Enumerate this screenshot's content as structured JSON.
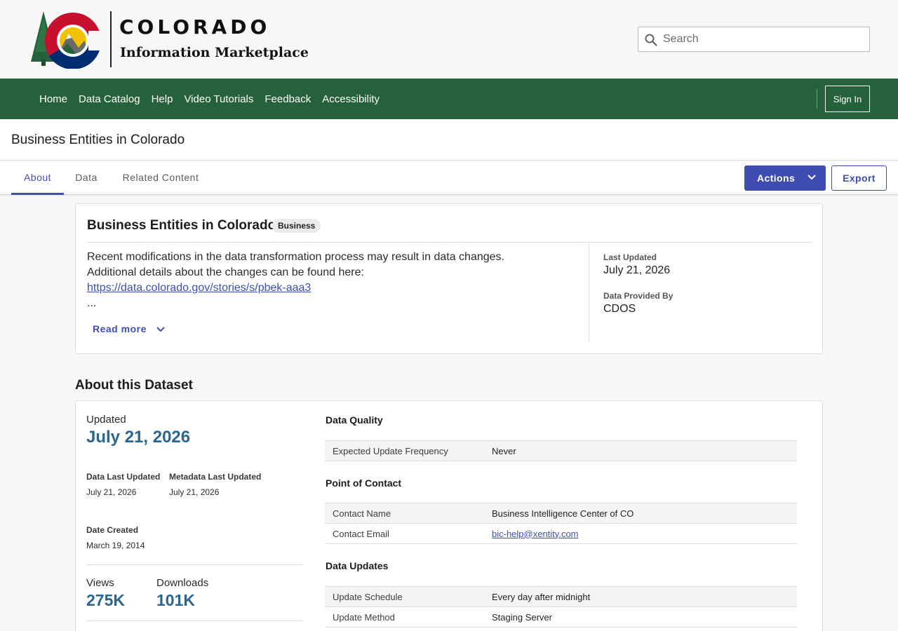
{
  "header": {
    "logo_title": "COLORADO",
    "logo_subtitle": "Information Marketplace",
    "logo_colors": {
      "red": "#c8102e",
      "blue": "#002d72",
      "gold": "#f2c200",
      "green": "#25613a"
    },
    "search": {
      "placeholder": "Search",
      "value": "",
      "icon": "search-icon"
    }
  },
  "nav": {
    "links": [
      "Home",
      "Data Catalog",
      "Help",
      "Video Tutorials",
      "Feedback",
      "Accessibility"
    ],
    "sign_in": "Sign In",
    "background": "#25613a"
  },
  "page": {
    "title": "Business Entities in Colorado"
  },
  "tabs": {
    "items": [
      "About",
      "Data",
      "Related Content"
    ],
    "active": "About",
    "actions_label": "Actions",
    "actions_icon": "chevron-down-icon",
    "export_label": "Export",
    "accent": "#3f4db3"
  },
  "summary": {
    "title": "Business Entities in Colorado",
    "badge": "Business",
    "desc_line1": "Recent modifications in the data transformation process may result in data changes.",
    "desc_line2": "Additional details about the changes can be found here:",
    "desc_link": "https://data.colorado.gov/stories/s/pbek-aaa3",
    "desc_ellipsis": "...",
    "read_more": "Read more",
    "last_updated_label": "Last Updated",
    "last_updated_value": "July 21, 2026",
    "provided_by_label": "Data Provided By",
    "provided_by_value": "CDOS"
  },
  "about": {
    "heading": "About this Dataset",
    "updated_label": "Updated",
    "updated_value": "July 21, 2026",
    "data_last_updated_label": "Data Last Updated",
    "data_last_updated_value": "July 21, 2026",
    "metadata_last_updated_label": "Metadata Last Updated",
    "metadata_last_updated_value": "July 21, 2026",
    "date_created_label": "Date Created",
    "date_created_value": "March 19, 2014",
    "views_label": "Views",
    "views_value": "275K",
    "downloads_label": "Downloads",
    "downloads_value": "101K",
    "data_quality": {
      "title": "Data Quality",
      "rows": [
        {
          "key": "Expected Update Frequency",
          "value": "Never"
        }
      ]
    },
    "point_of_contact": {
      "title": "Point of Contact",
      "rows": [
        {
          "key": "Contact Name",
          "value": "Business Intelligence Center of CO"
        },
        {
          "key": "Contact Email",
          "value": "bic-help@xentity.com"
        }
      ]
    },
    "data_updates": {
      "title": "Data Updates",
      "rows": [
        {
          "key": "Update Schedule",
          "value": "Every day after midnight"
        },
        {
          "key": "Update Method",
          "value": "Staging Server"
        }
      ]
    }
  }
}
